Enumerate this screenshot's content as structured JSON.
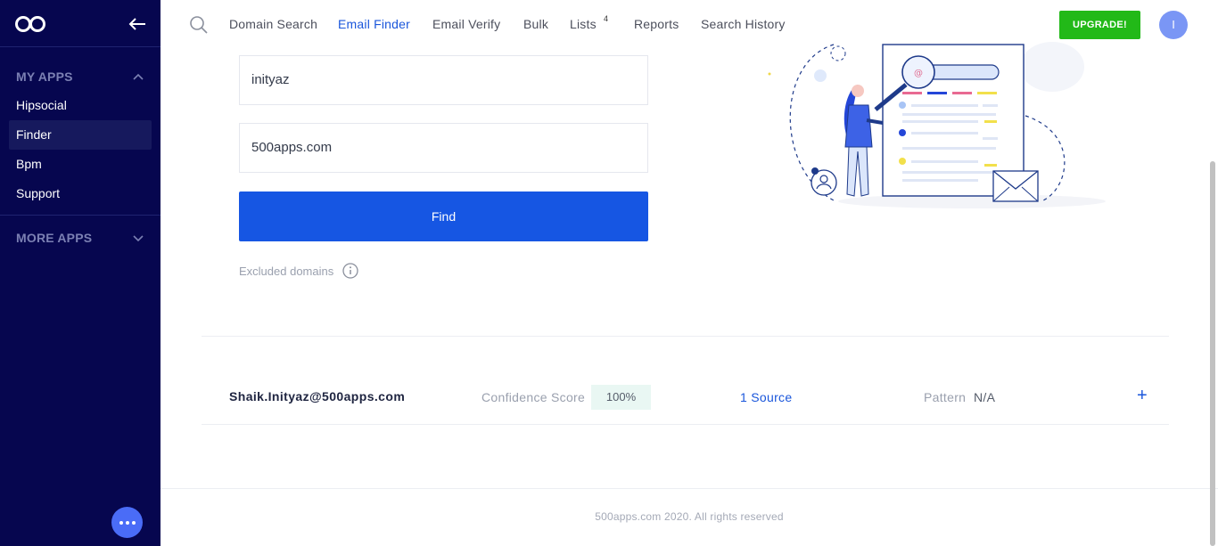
{
  "sidebar": {
    "logo_icon": "infinity-logo-icon",
    "collapse_icon": "arrow-left-icon",
    "my_apps_label": "MY APPS",
    "items": [
      {
        "label": "Hipsocial"
      },
      {
        "label": "Finder",
        "active": true
      },
      {
        "label": "Bpm"
      },
      {
        "label": "Support"
      }
    ],
    "more_apps_label": "MORE APPS",
    "chat_icon": "more-dots-icon"
  },
  "nav": {
    "search_icon": "search-icon",
    "items": [
      {
        "label": "Domain Search"
      },
      {
        "label": "Email Finder",
        "active": true
      },
      {
        "label": "Email Verify"
      },
      {
        "label": "Bulk"
      },
      {
        "label": "Lists",
        "badge": "4"
      },
      {
        "label": "Reports"
      },
      {
        "label": "Search History"
      }
    ],
    "upgrade_label": "UPGRADE!",
    "avatar_initial": "I"
  },
  "form": {
    "name_value": "inityaz",
    "domain_value": "500apps.com",
    "find_label": "Find",
    "excluded_label": "Excluded domains"
  },
  "result": {
    "email": "Shaik.Inityaz@500apps.com",
    "confidence_label": "Confidence Score",
    "confidence_value": "100%",
    "source_label": "1 Source",
    "pattern_label": "Pattern",
    "pattern_value": "N/A",
    "expand_label": "+"
  },
  "footer": {
    "text": "500apps.com 2020. All rights reserved"
  },
  "colors": {
    "sidebar_bg": "#06064f",
    "primary": "#1656e3",
    "upgrade": "#22b918",
    "confidence_bg": "#e9f7f3"
  }
}
